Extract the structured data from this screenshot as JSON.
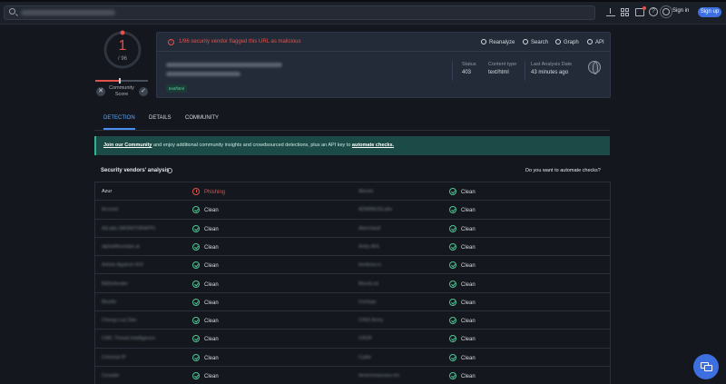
{
  "topbar": {
    "signin": "Sign in",
    "signup": "Sign up"
  },
  "score": {
    "malicious": "1",
    "total": "/ 96",
    "community_label": "Community Score"
  },
  "header": {
    "alert": "1/96 security vendor flagged this URL as malicious",
    "actions": {
      "reanalyze": "Reanalyze",
      "search": "Search",
      "graph": "Graph",
      "api": "API"
    },
    "tag": "text/html",
    "meta": [
      {
        "label": "Status",
        "value": "403"
      },
      {
        "label": "Content type",
        "value": "text/html"
      },
      {
        "label": "Last Analysis Date",
        "value": "43 minutes ago"
      }
    ]
  },
  "tabs": [
    "DETECTION",
    "DETAILS",
    "COMMUNITY"
  ],
  "banner": {
    "link1": "Join our Community",
    "text": " and enjoy additional community insights and crowdsourced detections, plus an API key to ",
    "link2": "automate checks."
  },
  "analysis": {
    "title": "Security vendors' analysis",
    "automate_q": "Do you want to automate checks?",
    "rows": [
      {
        "v1": "Azur",
        "r1": "Phishing",
        "v2": "Abusix",
        "r2": "Clean"
      },
      {
        "v1": "Acronis",
        "r1": "Clean",
        "v2": "ADMINUSLabs",
        "r2": "Clean"
      },
      {
        "v1": "AILabs (MONITORAPP)",
        "r1": "Clean",
        "v2": "AlienVault",
        "r2": "Clean"
      },
      {
        "v1": "alphaMountain.ai",
        "r1": "Clean",
        "v2": "Antiy-AVL",
        "r2": "Clean"
      },
      {
        "v1": "Artists Against 419",
        "r1": "Clean",
        "v2": "benkow.cc",
        "r2": "Clean"
      },
      {
        "v1": "BitDefender",
        "r1": "Clean",
        "v2": "BlockList",
        "r2": "Clean"
      },
      {
        "v1": "Blueliv",
        "r1": "Clean",
        "v2": "Certego",
        "r2": "Clean"
      },
      {
        "v1": "Chong Lua Dao",
        "r1": "Clean",
        "v2": "CINS Army",
        "r2": "Clean"
      },
      {
        "v1": "CMC Threat Intelligence",
        "r1": "Clean",
        "v2": "CRDF",
        "r2": "Clean"
      },
      {
        "v1": "Criminal IP",
        "r1": "Clean",
        "v2": "Cyble",
        "r2": "Clean"
      },
      {
        "v1": "Cyradar",
        "r1": "Clean",
        "v2": "desenmascara.me",
        "r2": "Clean"
      }
    ]
  }
}
